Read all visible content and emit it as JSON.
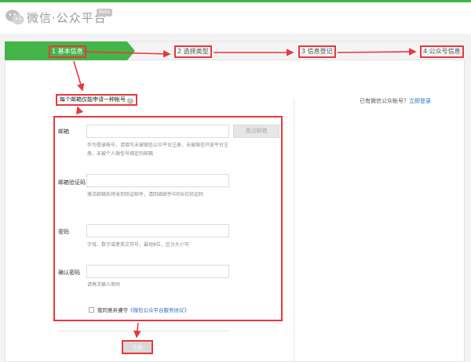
{
  "header": {
    "title": "微信·公众平台",
    "beta": "Beta"
  },
  "steps": [
    {
      "label": "1 基本信息",
      "active": true
    },
    {
      "label": "2 选择类型",
      "active": false
    },
    {
      "label": "3 信息登记",
      "active": false
    },
    {
      "label": "4 公众号信息",
      "active": false
    }
  ],
  "notice": {
    "text": "每个邮箱仅能申请一种帐号",
    "help": "?"
  },
  "login_hint": {
    "text": "已有微信公众帐号？",
    "link": "立即登录"
  },
  "form": {
    "email": {
      "label": "邮箱",
      "value": "",
      "button": "激活邮箱",
      "tip": "作为登录帐号，请填写未被微信公众平台注册，未被微信开放平台注册，未被个人微信号绑定的邮箱"
    },
    "code": {
      "label": "邮箱验证码",
      "value": "",
      "tip": "激活邮箱后将收到验证邮件，请回填邮件中的6位验证码"
    },
    "password": {
      "label": "密码",
      "value": "",
      "tip": "字母、数字或者英文符号，最短8位，区分大小写"
    },
    "confirm": {
      "label": "确认密码",
      "value": "",
      "tip": "请再次输入密码"
    },
    "agree": {
      "prefix": "我同意并遵守",
      "link": "《微信公众平台服务协议》"
    },
    "submit": "注册"
  },
  "colors": {
    "accent_green": "#44b549",
    "annotation_red": "#e8383d",
    "link_blue": "#2a6ebb"
  }
}
